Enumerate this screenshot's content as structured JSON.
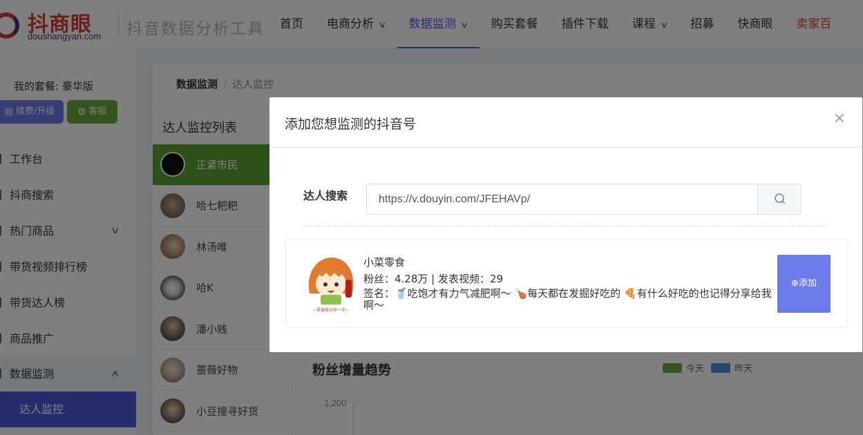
{
  "header": {
    "logo_text": "抖商眼",
    "logo_sub": "doushangyan.com",
    "tool_title": "抖音数据分析工具",
    "nav": [
      {
        "label": "首页",
        "dropdown": false
      },
      {
        "label": "电商分析",
        "dropdown": true
      },
      {
        "label": "数据监测",
        "dropdown": true,
        "active": true
      },
      {
        "label": "购买套餐",
        "dropdown": false
      },
      {
        "label": "插件下载",
        "dropdown": false
      },
      {
        "label": "课程",
        "dropdown": true
      },
      {
        "label": "招募",
        "dropdown": false
      },
      {
        "label": "快商眼",
        "dropdown": false
      },
      {
        "label": "卖家百",
        "dropdown": false
      }
    ]
  },
  "sidebar": {
    "plan": "我的套餐: 豪华版",
    "renew_label": "续费/升级",
    "service_label": "客服",
    "items": [
      {
        "label": "工作台"
      },
      {
        "label": "抖商搜索"
      },
      {
        "label": "热门商品"
      },
      {
        "label": "带货视频排行榜"
      },
      {
        "label": "带货达人榜"
      },
      {
        "label": "商品推广"
      },
      {
        "label": "数据监测"
      },
      {
        "label": "达人监控"
      }
    ]
  },
  "main": {
    "breadcrumb": [
      "数据监测",
      "/",
      "达人监控"
    ],
    "list_title": "达人监控列表",
    "list": [
      {
        "name": "正紧市民"
      },
      {
        "name": "哈七粑粑"
      },
      {
        "name": "林汤唯"
      },
      {
        "name": "哈K"
      },
      {
        "name": "潘小贱"
      },
      {
        "name": "蔷薇好物"
      },
      {
        "name": "小豆搜寻好货"
      }
    ],
    "chart_title": "粉丝增量趋势",
    "legend": [
      "今天",
      "昨天"
    ],
    "y_tick": "1,200"
  },
  "colors": {
    "accent": "#4e5bd9",
    "green": "#58a332",
    "blue_btn": "#6c7be8",
    "legend_today": "#6aa83a",
    "legend_yesterday": "#4d8fd6"
  },
  "modal": {
    "title": "添加您想监测的抖音号",
    "close": "×",
    "search_label": "达人搜索",
    "search_value": "https://v.douyin.com/JFEHAVp/",
    "result": {
      "name": "小菜零食",
      "stats": "粉丝：4.28万 | 发表视频：29",
      "signature": "签名：🥤吃饱才有力气减肥啊～ 🍗每天都在发掘好吃的 🍕有什么好吃的也记得分享给我啊～",
      "add_label": "⊕添加"
    }
  }
}
